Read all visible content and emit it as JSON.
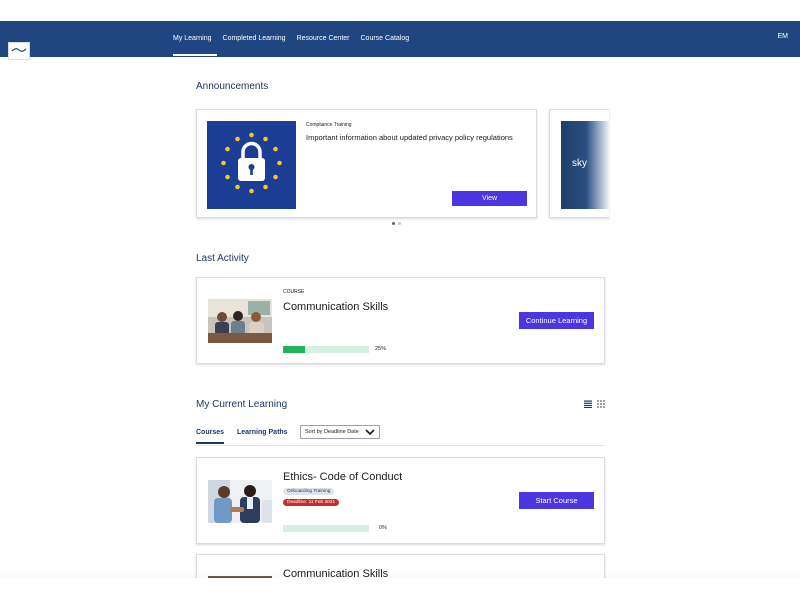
{
  "nav": {
    "items": [
      {
        "label": "My Learning",
        "active": true
      },
      {
        "label": "Completed Learning",
        "active": false
      },
      {
        "label": "Resource Center",
        "active": false
      },
      {
        "label": "Course Catalog",
        "active": false
      }
    ],
    "user_initials": "EM"
  },
  "announcements": {
    "title": "Announcements",
    "cards": [
      {
        "category": "Compliance Training",
        "text": "Important information about updated privacy policy regulations",
        "button": "View"
      },
      {
        "image_text": "sky"
      }
    ],
    "carousel_dots": 2,
    "active_dot": 0
  },
  "last_activity": {
    "title": "Last Activity",
    "category": "COURSE",
    "course_title": "Communication Skills",
    "progress": 25,
    "progress_label": "25%",
    "button": "Continue Learning"
  },
  "current_learning": {
    "title": "My Current Learning",
    "tabs": [
      {
        "label": "Courses",
        "active": true
      },
      {
        "label": "Learning Paths",
        "active": false
      }
    ],
    "sort_label": "Sort by Deadline Date",
    "courses": [
      {
        "title": "Ethics- Code of Conduct",
        "tag": "Onboarding Training",
        "deadline": "Deadline: 11 Feb 2021",
        "progress": 0,
        "progress_label": "0%",
        "button": "Start Course"
      },
      {
        "title": "Communication Skills"
      }
    ]
  },
  "colors": {
    "header": "#1f4680",
    "button": "#4c36e0",
    "progress": "#22b35a",
    "deadline": "#c82d2d"
  }
}
